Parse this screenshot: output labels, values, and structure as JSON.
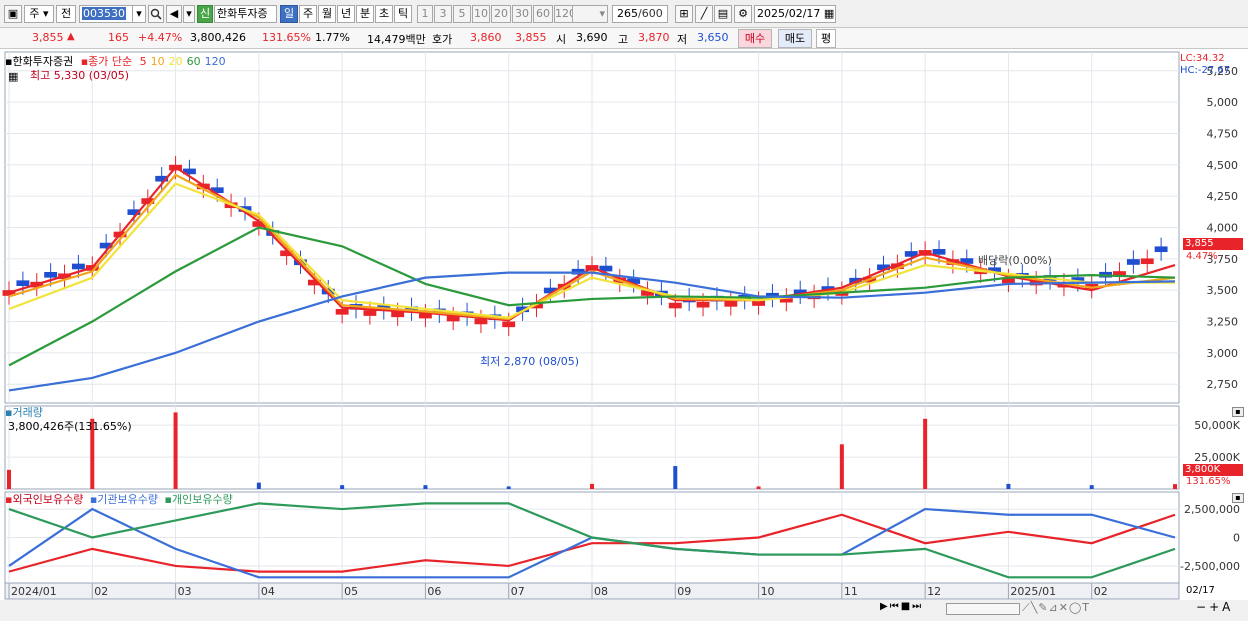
{
  "toolbar": {
    "type_label": "주",
    "prev_label": "전",
    "code": "003530",
    "badge": "신",
    "stock_name": "한화투자증",
    "periods": [
      "일",
      "주",
      "월",
      "년",
      "분",
      "초",
      "틱"
    ],
    "numbers": [
      "1",
      "3",
      "5",
      "10",
      "20",
      "30",
      "60",
      "120"
    ],
    "count": "265",
    "count_total": "/600",
    "date": "2025/02/17"
  },
  "quote": {
    "price": "3,855",
    "arrow": "▲",
    "change": "165",
    "change_pct": "+4.47%",
    "volume": "3,800,426",
    "vol_ratio": "131.65%",
    "turnover": "1.77%",
    "amount": "14,479백만",
    "ask_label": "호가",
    "ask": "3,860",
    "bid": "3,855",
    "open_label": "시",
    "open": "3,690",
    "high_label": "고",
    "high": "3,870",
    "low_label": "저",
    "low": "3,650",
    "buy_label": "매수",
    "sell_label": "매도",
    "eval_label": "평"
  },
  "price_panel": {
    "name": "한화투자증권",
    "ma_label": "종가 단순",
    "ma_periods": [
      {
        "p": "5",
        "color": "#e8242a"
      },
      {
        "p": "10",
        "color": "#f2a51a"
      },
      {
        "p": "20",
        "color": "#f2e33a"
      },
      {
        "p": "60",
        "color": "#2a9a3a"
      },
      {
        "p": "120",
        "color": "#3a6fd8"
      }
    ],
    "high_note": "최고 5,330 (03/05)",
    "low_note": "최저 2,870 (08/05)",
    "dividend_note": "배당락(0.00%)",
    "lc": "LC:34.32",
    "hc": "HC:-27.67",
    "last_price": "3,855",
    "last_pct": "4.47%",
    "y_ticks": [
      "5,250",
      "5,000",
      "4,750",
      "4,500",
      "4,250",
      "4,000",
      "3,750",
      "3,500",
      "3,250",
      "3,000",
      "2,750"
    ]
  },
  "volume_panel": {
    "title": "거래량",
    "value": "3,800,426주(131.65%)",
    "y_ticks": [
      "50,000K",
      "25,000K"
    ],
    "last_badge": "3,800K",
    "last_pct": "131.65%"
  },
  "holdings_panel": {
    "series_labels": [
      "외국인보유수량",
      "기관보유수량",
      "개인보유수량"
    ],
    "y_ticks": [
      "2,500,000",
      "0",
      "-2,500,000"
    ]
  },
  "x_axis": {
    "labels": [
      "2024/01",
      "02",
      "03",
      "04",
      "05",
      "06",
      "07",
      "08",
      "09",
      "10",
      "11",
      "12",
      "2025/01",
      "02"
    ],
    "last": "02/17"
  },
  "colors": {
    "up": "#e8242a",
    "down": "#1f4fd0",
    "ma5": "#e8242a",
    "ma10": "#f2a51a",
    "ma20": "#f2e33a",
    "ma60": "#2a9a3a",
    "ma120": "#3a6fd8",
    "foreign": "#e8242a",
    "institution": "#3a6fd8",
    "individual": "#2e9a5a"
  },
  "chart_data": {
    "type": "line",
    "title": "한화투자증권",
    "x": [
      "2024/01",
      "02",
      "03",
      "04",
      "05",
      "06",
      "07",
      "08",
      "09",
      "10",
      "11",
      "12",
      "2025/01",
      "02",
      "02/17"
    ],
    "series": [
      {
        "name": "종가",
        "values": [
          3500,
          3700,
          4500,
          4050,
          3350,
          3320,
          3250,
          3700,
          3400,
          3420,
          3500,
          3820,
          3600,
          3550,
          3855
        ]
      },
      {
        "name": "5",
        "values": [
          3480,
          3680,
          4480,
          4050,
          3360,
          3320,
          3260,
          3680,
          3420,
          3420,
          3520,
          3800,
          3610,
          3500,
          3700
        ]
      },
      {
        "name": "10",
        "values": [
          3450,
          3650,
          4420,
          4080,
          3380,
          3330,
          3270,
          3650,
          3430,
          3420,
          3500,
          3760,
          3620,
          3520,
          3600
        ]
      },
      {
        "name": "20",
        "values": [
          3350,
          3600,
          4350,
          4100,
          3420,
          3350,
          3280,
          3600,
          3450,
          3420,
          3480,
          3700,
          3630,
          3560,
          3560
        ]
      },
      {
        "name": "60",
        "values": [
          2900,
          3250,
          3650,
          4000,
          3850,
          3550,
          3380,
          3430,
          3450,
          3440,
          3480,
          3520,
          3600,
          3620,
          3600
        ]
      },
      {
        "name": "120",
        "values": [
          2700,
          2800,
          3000,
          3250,
          3450,
          3600,
          3640,
          3640,
          3560,
          3450,
          3440,
          3480,
          3550,
          3560,
          3570
        ]
      }
    ],
    "volume_x": [
      "2024/01",
      "02",
      "03",
      "04",
      "05",
      "06",
      "07",
      "08",
      "09",
      "10",
      "11",
      "12",
      "2025/01",
      "02",
      "02/17"
    ],
    "volume": [
      15000,
      55000,
      60000,
      5000,
      3000,
      3000,
      2000,
      4000,
      18000,
      2000,
      35000,
      55000,
      4000,
      3000,
      3800
    ],
    "holdings": [
      {
        "name": "외국인보유수량",
        "values": [
          -3000000,
          -1000000,
          -2500000,
          -3000000,
          -3000000,
          -2000000,
          -2500000,
          -500000,
          -500000,
          0,
          2000000,
          -500000,
          500000,
          -500000,
          2000000
        ]
      },
      {
        "name": "기관보유수량",
        "values": [
          -2500000,
          2500000,
          -1000000,
          -3500000,
          -3500000,
          -3500000,
          -3500000,
          0,
          -1000000,
          -1500000,
          -1500000,
          2500000,
          2000000,
          2000000,
          0
        ]
      },
      {
        "name": "개인보유수량",
        "values": [
          2500000,
          0,
          1500000,
          3000000,
          2500000,
          3000000,
          3000000,
          0,
          -1000000,
          -1500000,
          -1500000,
          -1000000,
          -3500000,
          -3500000,
          -1000000
        ]
      }
    ],
    "ylim": [
      2600,
      5400
    ],
    "grid": true,
    "legend": "top-left"
  }
}
